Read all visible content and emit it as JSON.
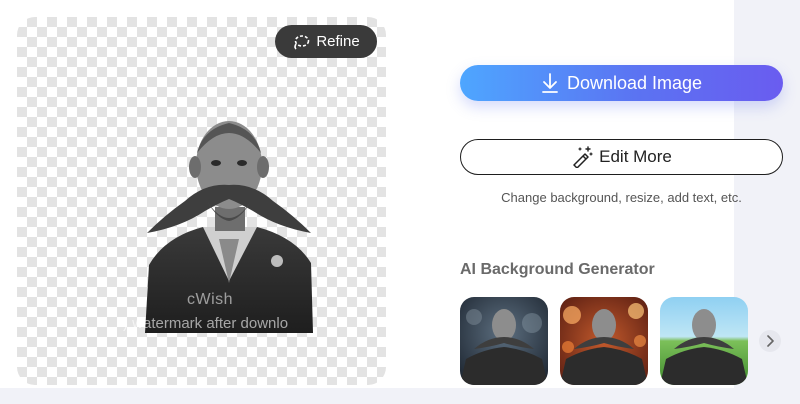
{
  "preview": {
    "refine_label": "Refine",
    "watermark_brand": "cWish",
    "watermark_note": ") watermark after downlo"
  },
  "actions": {
    "download_label": "Download Image",
    "edit_label": "Edit More",
    "edit_hint": "Change background, resize, add text, etc."
  },
  "ai_generator": {
    "title": "AI Background Generator",
    "thumbnails": [
      "dark-bokeh-background",
      "orange-bokeh-background",
      "green-field-background"
    ]
  },
  "colors": {
    "download_gradient_start": "#4ea6ff",
    "download_gradient_end": "#6a5cf0",
    "refine_bg": "#3a3a3a"
  },
  "icons": {
    "refine": "lasso-icon",
    "download": "download-arrow-icon",
    "edit": "magic-wand-icon",
    "next": "chevron-right-icon"
  }
}
